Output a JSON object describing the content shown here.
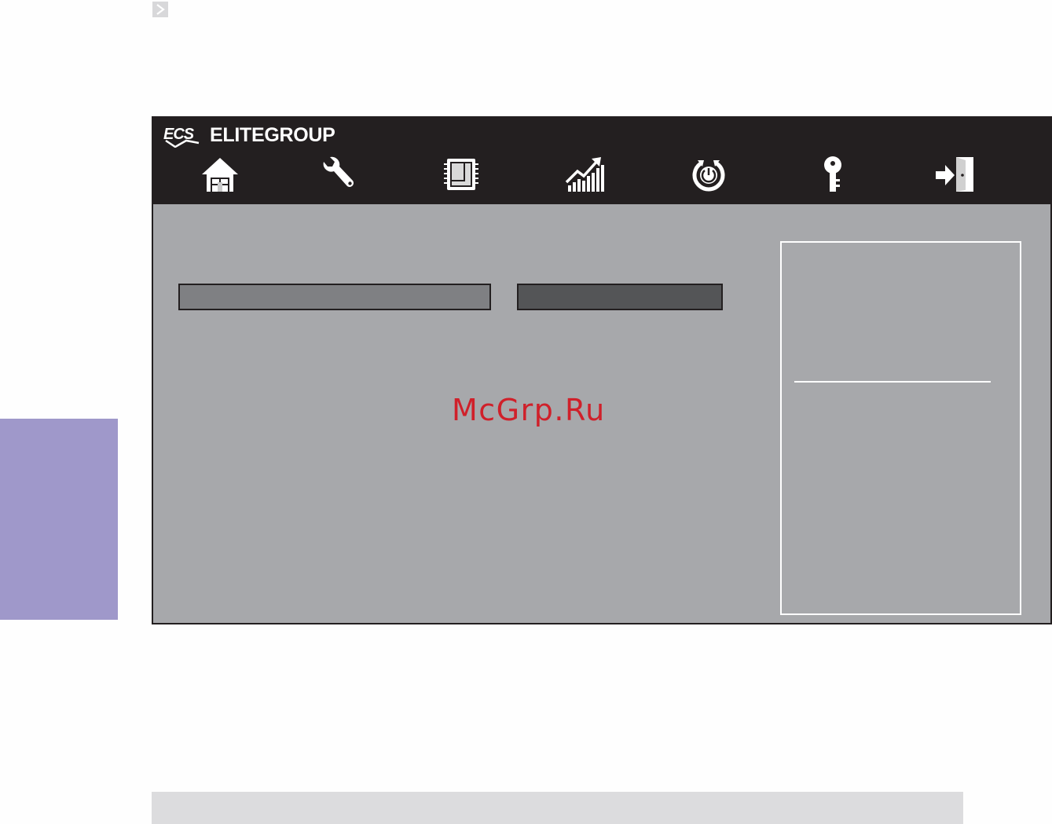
{
  "header": {
    "brand_name": "ELITEGROUP",
    "logo": "ECS",
    "logo_icon": "ecs-logo-icon"
  },
  "nav_icons": [
    {
      "name": "home-icon"
    },
    {
      "name": "wrench-icon"
    },
    {
      "name": "chip-icon"
    },
    {
      "name": "chart-icon"
    },
    {
      "name": "power-icon"
    },
    {
      "name": "key-icon"
    },
    {
      "name": "exit-icon"
    }
  ],
  "watermark": "McGrp.Ru",
  "colors": {
    "header_bg": "#231f20",
    "body_bg": "#a7a8ab",
    "side_tab": "#9f98ca",
    "watermark": "#d0202a",
    "footer_bar": "#dcdcde"
  }
}
